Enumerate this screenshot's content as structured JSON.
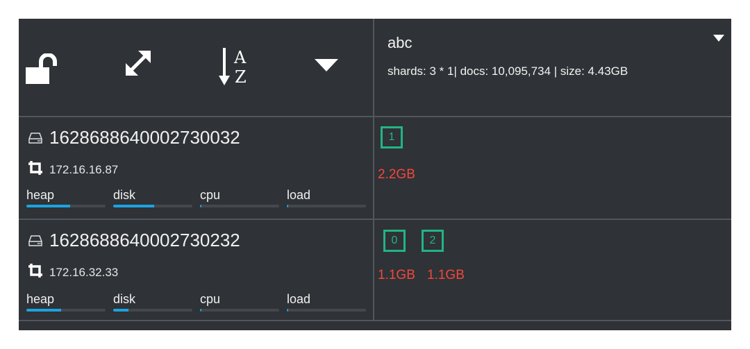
{
  "toolbar": {
    "icons": [
      "unlock-icon",
      "expand-icon",
      "sort-alpha-icon",
      "caret-down-icon"
    ]
  },
  "index": {
    "name": "abc",
    "stats": "shards: 3 * 1| docs: 10,095,734 | size: 4.43GB"
  },
  "nodes": [
    {
      "name": "1628688640002730032",
      "ip": "172.16.16.87",
      "metrics": [
        {
          "label": "heap",
          "level": 0.55
        },
        {
          "label": "disk",
          "level": 0.52
        },
        {
          "label": "cpu",
          "level": 0.02
        },
        {
          "label": "load",
          "level": 0.02
        }
      ],
      "shards": [
        {
          "id": "1",
          "size": "2.2GB"
        }
      ]
    },
    {
      "name": "1628688640002730232",
      "ip": "172.16.32.33",
      "metrics": [
        {
          "label": "heap",
          "level": 0.44
        },
        {
          "label": "disk",
          "level": 0.19
        },
        {
          "label": "cpu",
          "level": 0.02
        },
        {
          "label": "load",
          "level": 0.02
        }
      ],
      "shards": [
        {
          "id": "0",
          "size": "1.1GB"
        },
        {
          "id": "2",
          "size": "1.1GB"
        }
      ]
    }
  ],
  "colors": {
    "background": "#2f3236",
    "divider": "#52575d",
    "bar": "#1ca3e0",
    "shard": "#21b583",
    "size_text": "#f2483b"
  }
}
